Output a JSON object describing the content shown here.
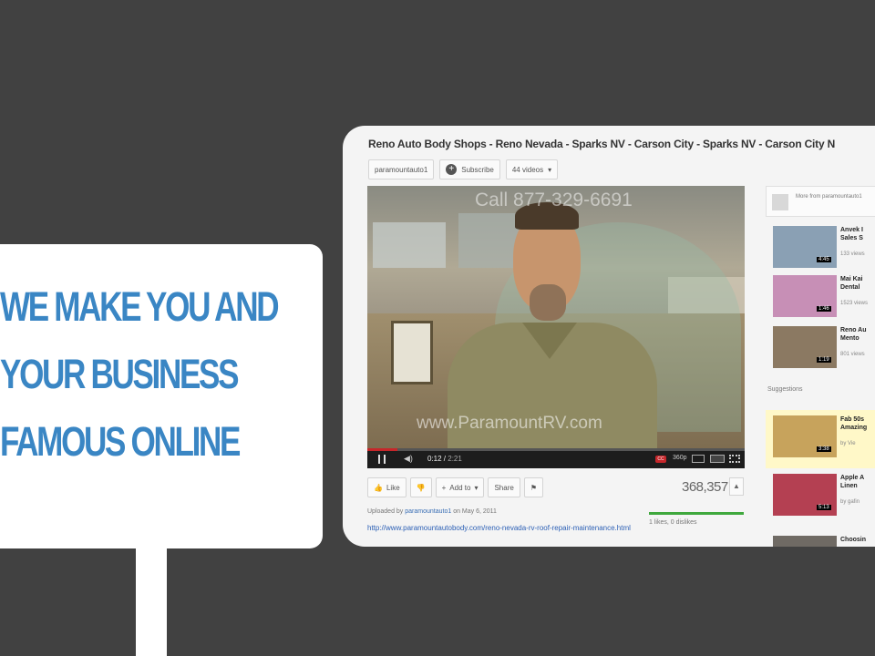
{
  "sign": {
    "lines": [
      "WE MAKE YOU AND",
      "YOUR BUSINESS",
      "FAMOUS ONLINE"
    ]
  },
  "video_page": {
    "title": "Reno Auto Body Shops - Reno Nevada - Sparks NV - Carson City - Sparks NV - Carson City N",
    "channel": "paramountauto1",
    "subscribe_label": "Subscribe",
    "videos_label": "44 videos",
    "player": {
      "overlay_phone": "Call 877-329-6691",
      "overlay_site": "www.ParamountRV.com",
      "current_time": "0:12",
      "duration": "2:21",
      "progress": 0.08,
      "quality": "360p",
      "cc_label": "CC"
    },
    "actions": {
      "like": "Like",
      "add_to": "Add to",
      "share": "Share"
    },
    "view_count": "368,357",
    "uploaded_by": "Uploaded by",
    "uploader": "paramountauto1",
    "upload_date": "on May 6, 2011",
    "description_link": "http://www.paramountautobody.com/reno-nevada-rv-roof-repair-maintenance.html",
    "likes_text": "1 likes, 0 dislikes",
    "like_ratio": 1.0
  },
  "sidebar": {
    "more_from": "More from paramountauto1",
    "suggestions_label": "Suggestions",
    "related": [
      {
        "title": "Anvek I",
        "sub": "Sales S",
        "meta": "133 views",
        "duration": "4:45",
        "thumb_color": "#8aa0b4"
      },
      {
        "title": "Mai Kai",
        "sub": "Dental",
        "meta": "1523 views",
        "duration": "1:46",
        "thumb_color": "#c78fb6"
      },
      {
        "title": "Reno Au",
        "sub": "Mento",
        "meta": "801 views",
        "duration": "1:19",
        "thumb_color": "#8b7962"
      },
      {
        "title": "Fab 50s",
        "sub": "Amazing",
        "meta": "by Vie",
        "duration": "3:38",
        "thumb_color": "#c7a35c"
      },
      {
        "title": "Apple A",
        "sub": "Linen",
        "meta": "by gafin",
        "duration": "5:13",
        "thumb_color": "#b44052"
      },
      {
        "title": "Choosin",
        "sub": "",
        "meta": "",
        "duration": "",
        "thumb_color": "#6f6a64"
      }
    ]
  },
  "colors": {
    "background": "#414141",
    "sign_text": "#3a86c4",
    "progress": "#c6262a",
    "like_bar": "#3fa83d"
  }
}
